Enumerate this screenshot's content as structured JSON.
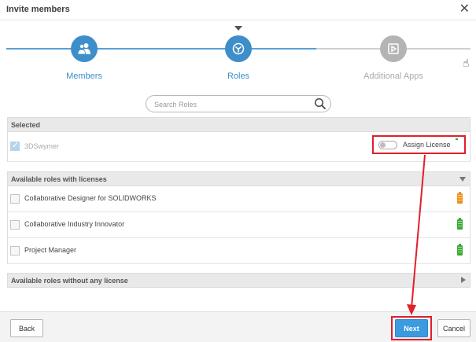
{
  "dialog": {
    "title": "Invite members",
    "close_icon": "close-icon"
  },
  "stepper": {
    "steps": [
      {
        "label": "Members",
        "icon": "users-icon",
        "state": "active"
      },
      {
        "label": "Roles",
        "icon": "roles-icon",
        "state": "current"
      },
      {
        "label": "Additional Apps",
        "icon": "apps-icon",
        "state": "inactive"
      }
    ]
  },
  "search": {
    "placeholder": "Search Roles",
    "value": ""
  },
  "selected": {
    "header": "Selected",
    "items": [
      {
        "name": "3DSwymer",
        "checked": true,
        "assign_license_label": "Assign License",
        "license_status": "green"
      }
    ]
  },
  "available_with_licenses": {
    "header": "Available roles with licenses",
    "items": [
      {
        "name": "Collaborative Designer for SOLIDWORKS",
        "checked": false,
        "license_status": "orange"
      },
      {
        "name": "Collaborative Industry Innovator",
        "checked": false,
        "license_status": "green"
      },
      {
        "name": "Project Manager",
        "checked": false,
        "license_status": "green"
      }
    ]
  },
  "available_without_license": {
    "header": "Available roles without any license"
  },
  "footer": {
    "back_label": "Back",
    "next_label": "Next",
    "cancel_label": "Cancel"
  },
  "colors": {
    "accent": "#3d8ec9",
    "highlight": "#e0202a",
    "license_ok": "#3aaa35",
    "license_warn": "#f0901a"
  }
}
